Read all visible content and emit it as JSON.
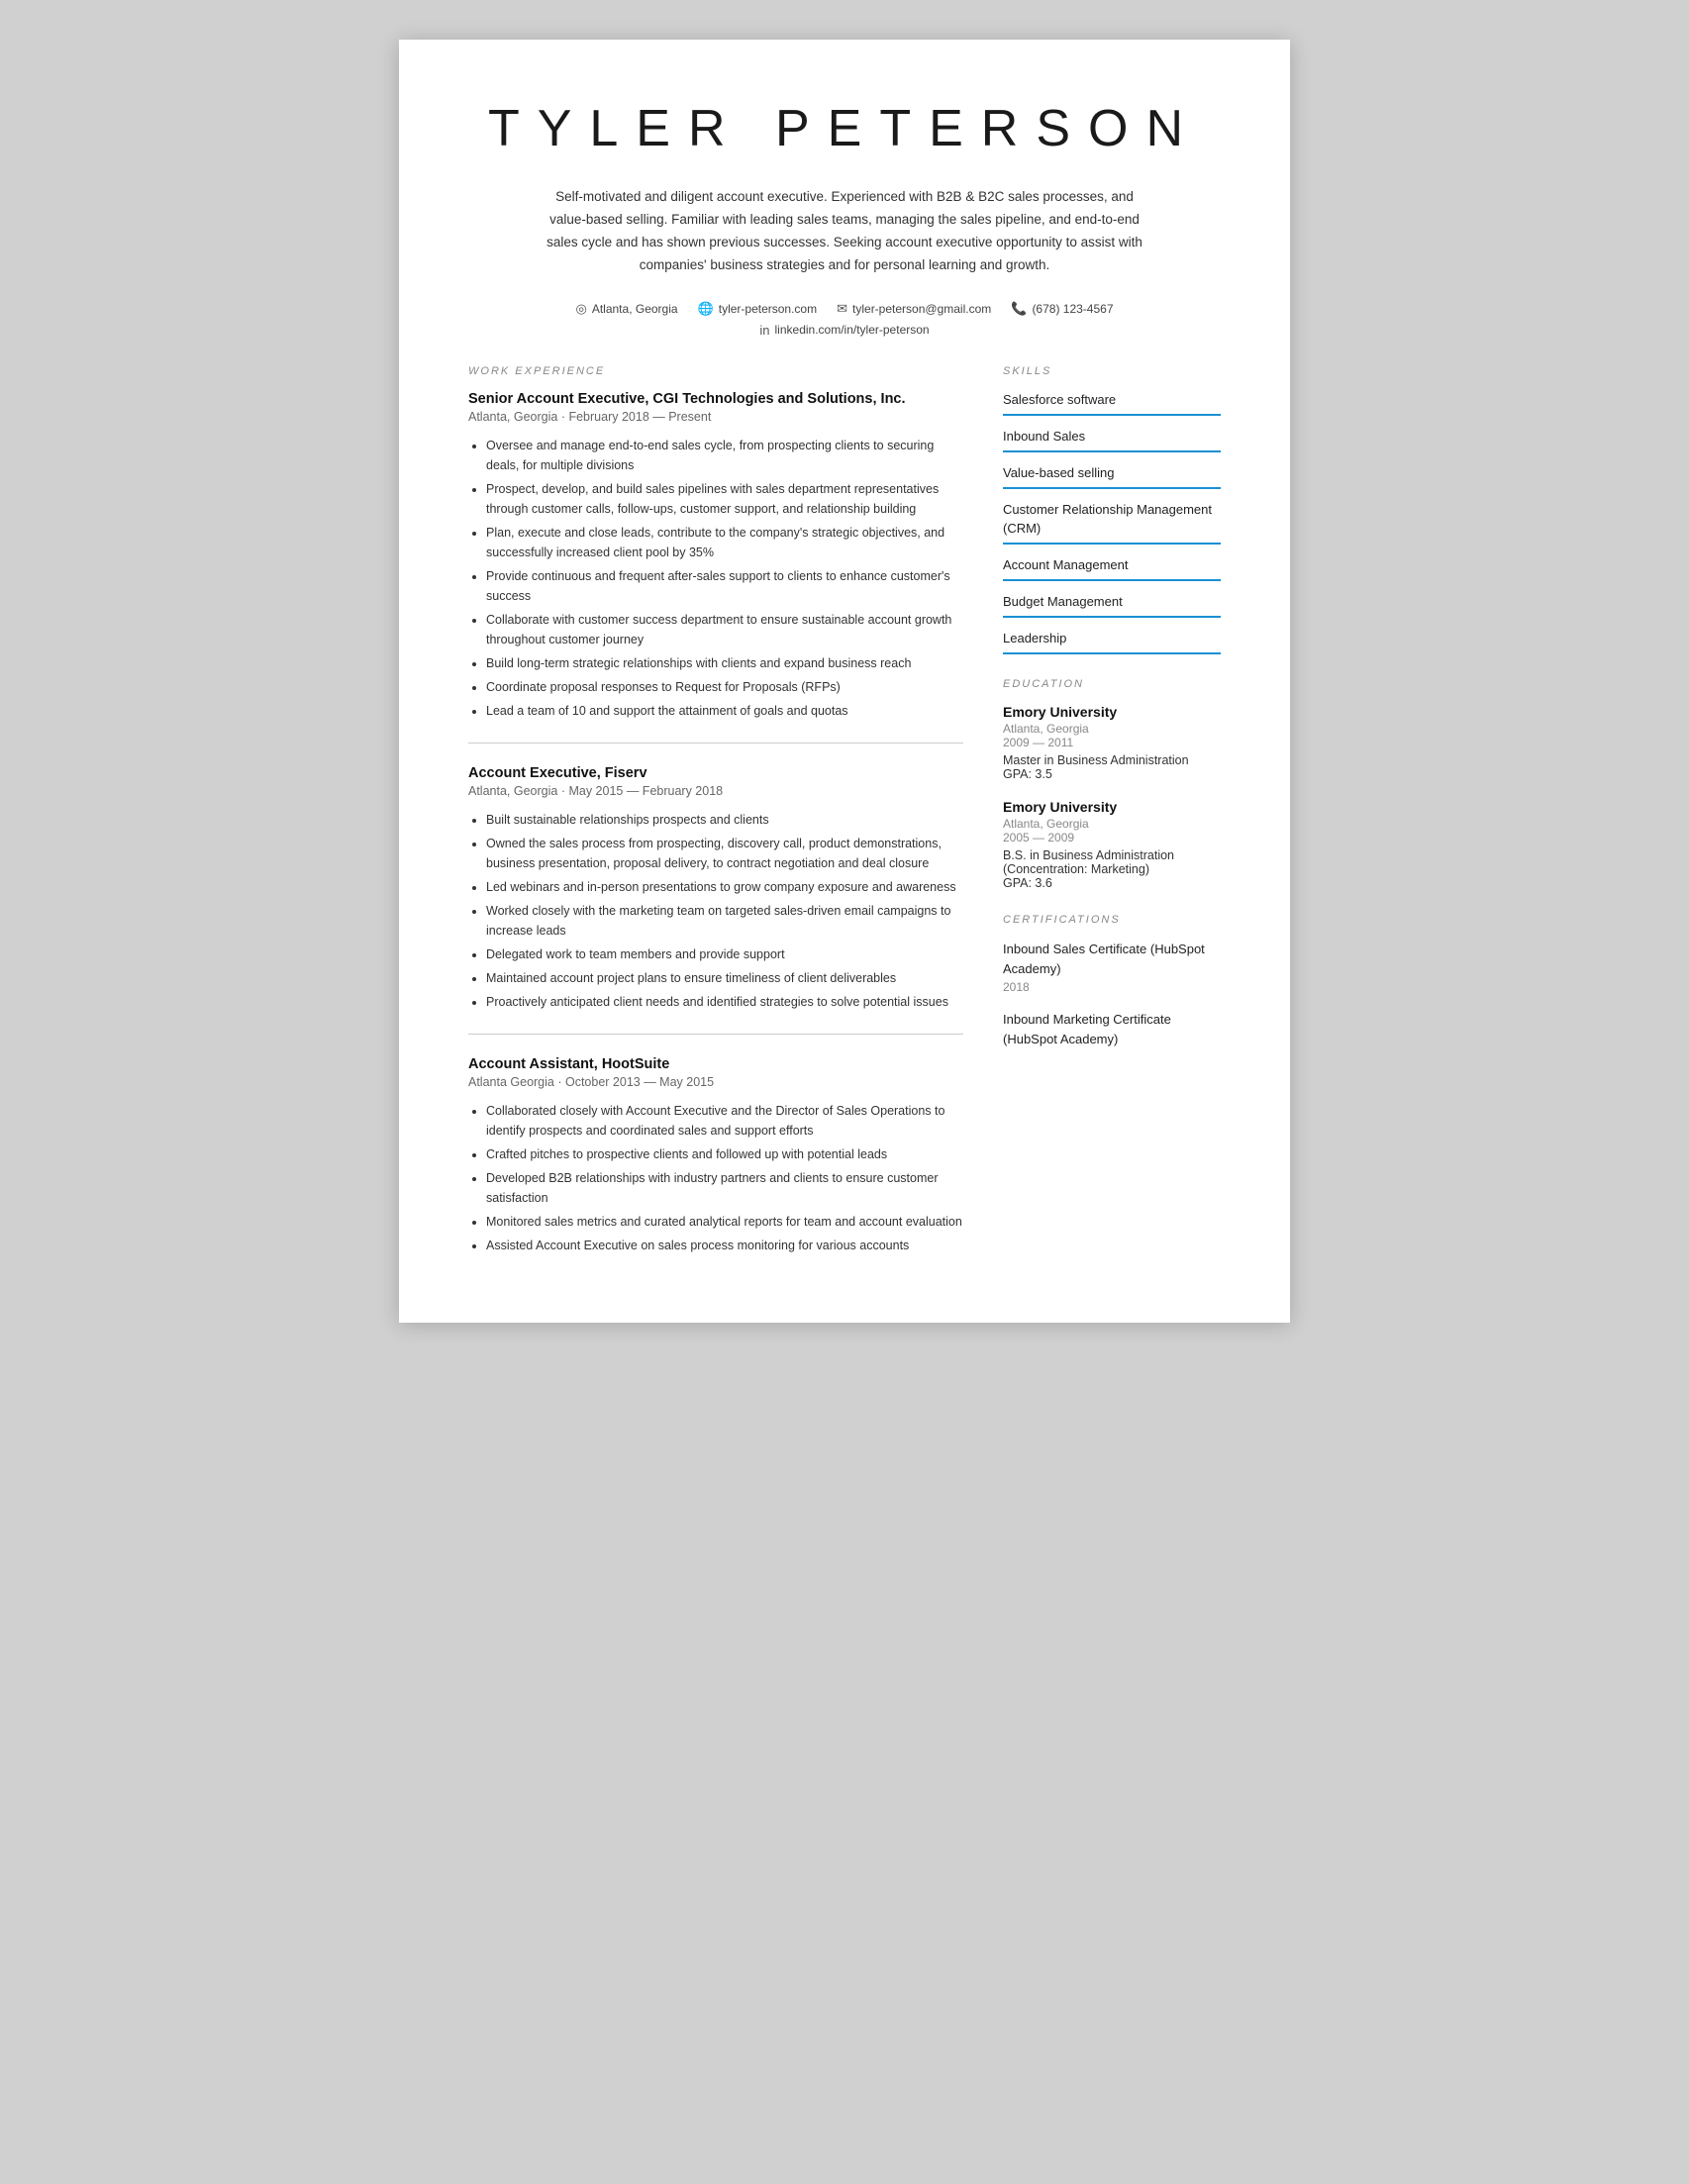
{
  "header": {
    "name": "TYLER PETERSON",
    "summary": "Self-motivated and diligent account executive. Experienced with B2B & B2C sales processes, and value-based selling. Familiar with leading sales teams, managing the sales pipeline, and end-to-end sales cycle and has shown previous successes. Seeking account executive opportunity to assist with companies' business strategies and for personal learning and growth."
  },
  "contact": {
    "location": "Atlanta, Georgia",
    "website": "tyler-peterson.com",
    "email": "tyler-peterson@gmail.com",
    "phone": "(678) 123-4567",
    "linkedin": "linkedin.com/in/tyler-peterson"
  },
  "sections": {
    "work_experience_label": "WORK EXPERIENCE",
    "skills_label": "SKILLS",
    "education_label": "EDUCATION",
    "certifications_label": "CERTIFICATIONS"
  },
  "work_experience": [
    {
      "title": "Senior Account Executive, CGI Technologies and Solutions, Inc.",
      "location": "Atlanta, Georgia",
      "dates": "February 2018 — Present",
      "bullets": [
        "Oversee and manage end-to-end sales cycle, from prospecting clients to securing deals, for multiple divisions",
        "Prospect, develop, and build sales pipelines with sales department representatives through customer calls, follow-ups, customer support, and relationship building",
        "Plan, execute and close leads, contribute to the company's strategic objectives, and successfully increased client pool by 35%",
        "Provide continuous and frequent after-sales support to clients to enhance customer's success",
        "Collaborate with customer success department to ensure sustainable account growth throughout customer journey",
        "Build long-term strategic relationships with clients and expand business reach",
        "Coordinate proposal responses to Request for Proposals (RFPs)",
        "Lead a team of 10 and support the attainment of goals and quotas"
      ]
    },
    {
      "title": "Account Executive, Fiserv",
      "location": "Atlanta, Georgia",
      "dates": "May 2015 — February 2018",
      "bullets": [
        "Built sustainable relationships prospects and clients",
        "Owned the sales process from prospecting, discovery call, product demonstrations, business presentation, proposal delivery, to contract negotiation and deal closure",
        "Led webinars and in-person presentations to grow company exposure and awareness",
        "Worked closely with the marketing team on targeted sales-driven email campaigns to increase leads",
        "Delegated work to team members and provide support",
        "Maintained account project plans to ensure timeliness of client deliverables",
        "Proactively anticipated client needs and identified strategies to solve potential issues"
      ]
    },
    {
      "title": "Account Assistant, HootSuite",
      "location": "Atlanta Georgia",
      "dates": "October 2013 — May 2015",
      "bullets": [
        "Collaborated closely with Account Executive and the Director of Sales Operations to identify prospects and coordinated sales and support efforts",
        "Crafted pitches to prospective clients and followed up with potential leads",
        "Developed B2B relationships with industry partners and clients to ensure customer satisfaction",
        "Monitored sales metrics and curated analytical reports for team and account evaluation",
        "Assisted Account Executive on sales process monitoring for various accounts"
      ]
    }
  ],
  "skills": [
    "Salesforce software",
    "Inbound Sales",
    "Value-based selling",
    "Customer Relationship Management (CRM)",
    "Account Management",
    "Budget Management",
    "Leadership"
  ],
  "education": [
    {
      "school": "Emory University",
      "location": "Atlanta, Georgia",
      "years": "2009 — 2011",
      "degree": "Master in Business Administration",
      "gpa": "GPA: 3.5"
    },
    {
      "school": "Emory University",
      "location": "Atlanta, Georgia",
      "years": "2005 — 2009",
      "degree": "B.S. in Business Administration (Concentration: Marketing)",
      "gpa": "GPA: 3.6"
    }
  ],
  "certifications": [
    {
      "name": "Inbound Sales Certificate (HubSpot Academy)",
      "year": "2018"
    },
    {
      "name": "Inbound Marketing Certificate (HubSpot Academy)",
      "year": ""
    }
  ]
}
